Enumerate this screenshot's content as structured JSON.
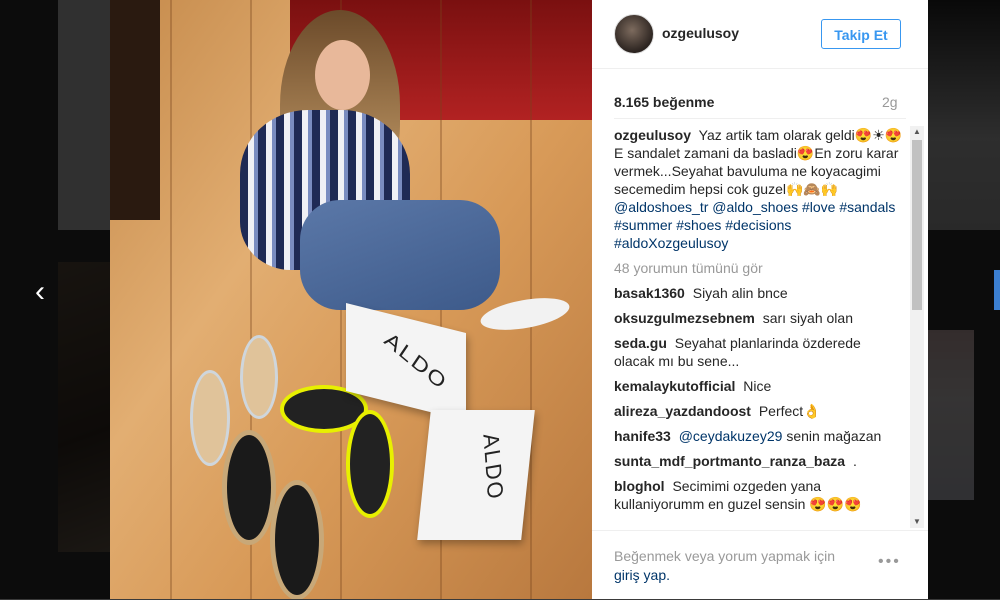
{
  "post": {
    "username": "ozgeulusoy",
    "follow_label": "Takip Et",
    "likes": "8.165 beğenme",
    "age": "2g",
    "caption_user": "ozgeulusoy",
    "caption_text": "Yaz artik tam olarak geldi😍☀😍E sandalet zamani da basladi😍En zoru karar vermek...Seyahat bavuluma ne koyacagimi secemedim hepsi cok guzel🙌🙈🙌",
    "caption_tags": "@aldoshoes_tr @aldo_shoes #love #sandals #summer #shoes #decisions #aldoXozgeulusoy",
    "load_more": "48 yorumun tümünü gör",
    "comments": [
      {
        "user": "basak1360",
        "text": "Siyah alin bnce",
        "mention": ""
      },
      {
        "user": "oksuzgulmezsebnem",
        "text": "sarı siyah olan",
        "mention": ""
      },
      {
        "user": "seda.gu",
        "text": "Seyahat planlarinda özderede olacak mı bu sene...",
        "mention": ""
      },
      {
        "user": "kemalaykutofficial",
        "text": "Nice",
        "mention": ""
      },
      {
        "user": "alireza_yazdandoost",
        "text": "Perfect👌",
        "mention": ""
      },
      {
        "user": "hanife33",
        "text": "senin mağazan",
        "mention": "@ceydakuzey29"
      },
      {
        "user": "sunta_mdf_portmanto_ranza_baza",
        "text": ".",
        "mention": ""
      },
      {
        "user": "bloghol",
        "text": "Secimimi ozgeden yana kullaniyorumm en guzel sensin 😍😍😍",
        "mention": ""
      }
    ],
    "footer_text": "Beğenmek veya yorum yapmak için",
    "footer_login": "giriş yap.",
    "more_icon": "•••",
    "box_label": "ALDO"
  },
  "nav": {
    "prev_icon": "‹"
  }
}
